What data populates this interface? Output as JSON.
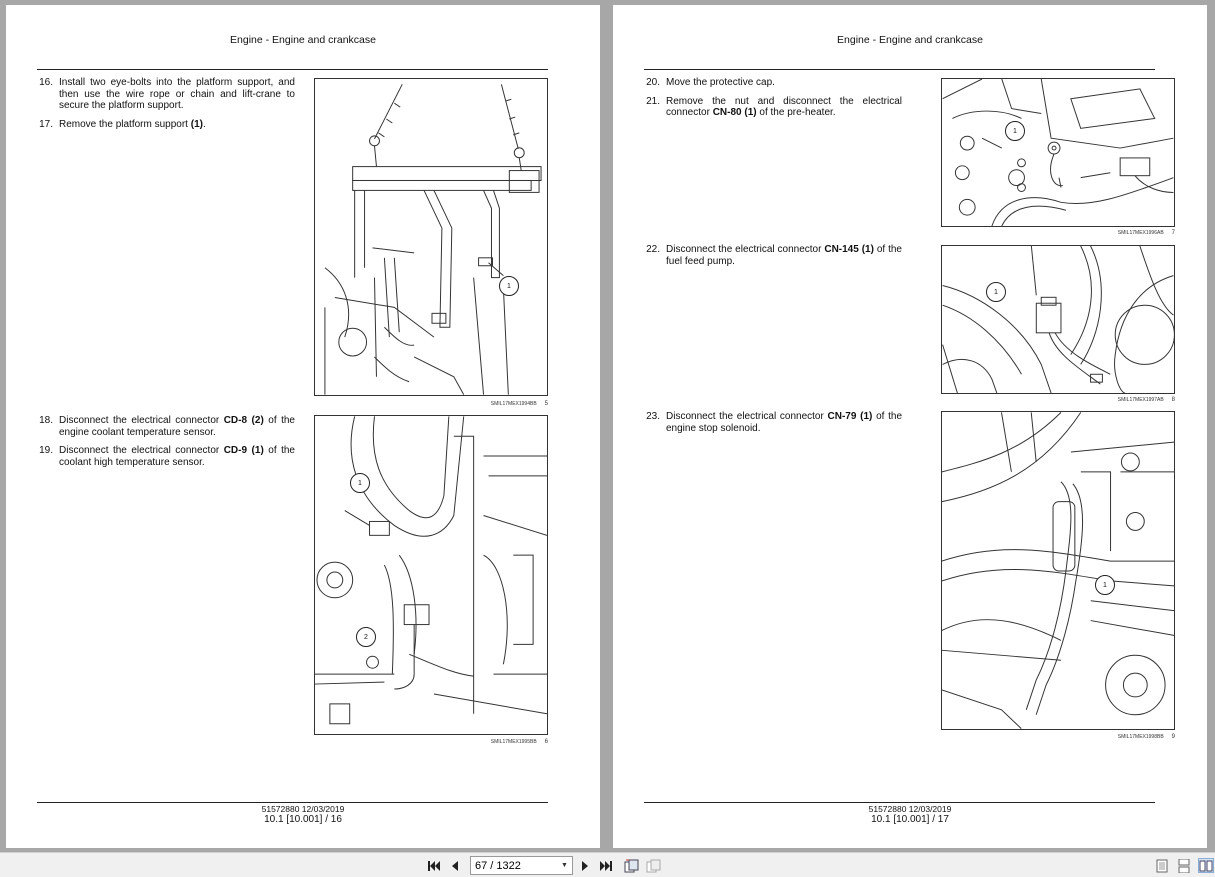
{
  "pages": [
    {
      "header": "Engine - Engine and crankcase",
      "groups": [
        {
          "steps": [
            {
              "num": "16.",
              "parts": [
                {
                  "t": "Install two eye-bolts into the platform support, and then use the wire rope or chain and lift-crane to secure the platform support."
                }
              ]
            },
            {
              "num": "17.",
              "parts": [
                {
                  "t": "Remove the platform support "
                },
                {
                  "t": "(1)",
                  "b": true
                },
                {
                  "t": "."
                }
              ]
            }
          ],
          "figure": {
            "code": "SMIL17MEX1994BB",
            "num": "5",
            "callouts": [
              "1"
            ]
          }
        },
        {
          "steps": [
            {
              "num": "18.",
              "parts": [
                {
                  "t": "Disconnect the electrical connector "
                },
                {
                  "t": "CD-8",
                  "b": true
                },
                {
                  "t": " "
                },
                {
                  "t": "(2)",
                  "b": true
                },
                {
                  "t": " of the engine coolant temperature sensor."
                }
              ]
            },
            {
              "num": "19.",
              "parts": [
                {
                  "t": "Disconnect the electrical connector "
                },
                {
                  "t": "CD-9",
                  "b": true
                },
                {
                  "t": " "
                },
                {
                  "t": "(1)",
                  "b": true
                },
                {
                  "t": " of the coolant high temperature sensor."
                }
              ]
            }
          ],
          "figure": {
            "code": "SMIL17MEX1995BB",
            "num": "6",
            "callouts": [
              "1",
              "2"
            ]
          }
        }
      ],
      "footer_doc": "51572880 12/03/2019",
      "footer_page": "10.1 [10.001] / 16"
    },
    {
      "header": "Engine - Engine and crankcase",
      "groups": [
        {
          "steps": [
            {
              "num": "20.",
              "parts": [
                {
                  "t": "Move the protective cap."
                }
              ]
            },
            {
              "num": "21.",
              "parts": [
                {
                  "t": "Remove the nut and disconnect the electrical connector "
                },
                {
                  "t": "CN-80",
                  "b": true
                },
                {
                  "t": " "
                },
                {
                  "t": "(1)",
                  "b": true
                },
                {
                  "t": " of the pre-heater."
                }
              ]
            }
          ],
          "figure": {
            "code": "SMIL17MEX1996AB",
            "num": "7",
            "callouts": [
              "1"
            ]
          }
        },
        {
          "steps": [
            {
              "num": "22.",
              "parts": [
                {
                  "t": "Disconnect the electrical connector "
                },
                {
                  "t": "CN-145",
                  "b": true
                },
                {
                  "t": " "
                },
                {
                  "t": "(1)",
                  "b": true
                },
                {
                  "t": " of the fuel feed pump."
                }
              ]
            }
          ],
          "figure": {
            "code": "SMIL17MEX1997AB",
            "num": "8",
            "callouts": [
              "1"
            ]
          }
        },
        {
          "steps": [
            {
              "num": "23.",
              "parts": [
                {
                  "t": "Disconnect the electrical connector "
                },
                {
                  "t": "CN-79",
                  "b": true
                },
                {
                  "t": " "
                },
                {
                  "t": "(1)",
                  "b": true
                },
                {
                  "t": " of the engine stop solenoid."
                }
              ]
            }
          ],
          "figure": {
            "code": "SMIL17MEX1998BB",
            "num": "9",
            "callouts": [
              "1"
            ]
          }
        }
      ],
      "footer_doc": "51572880 12/03/2019",
      "footer_page": "10.1 [10.001] / 17"
    }
  ],
  "toolbar": {
    "first_icon": "first-page-icon",
    "prev_icon": "previous-page-icon",
    "page_value": "67 / 1322",
    "next_icon": "next-page-icon",
    "last_icon": "last-page-icon",
    "rotate_icon": "rotate-icon",
    "rotate2_icon": "rotate-disabled-icon",
    "single_icon": "single-page-view-icon",
    "continuous_icon": "continuous-view-icon",
    "facing_icon": "facing-pages-view-icon"
  }
}
